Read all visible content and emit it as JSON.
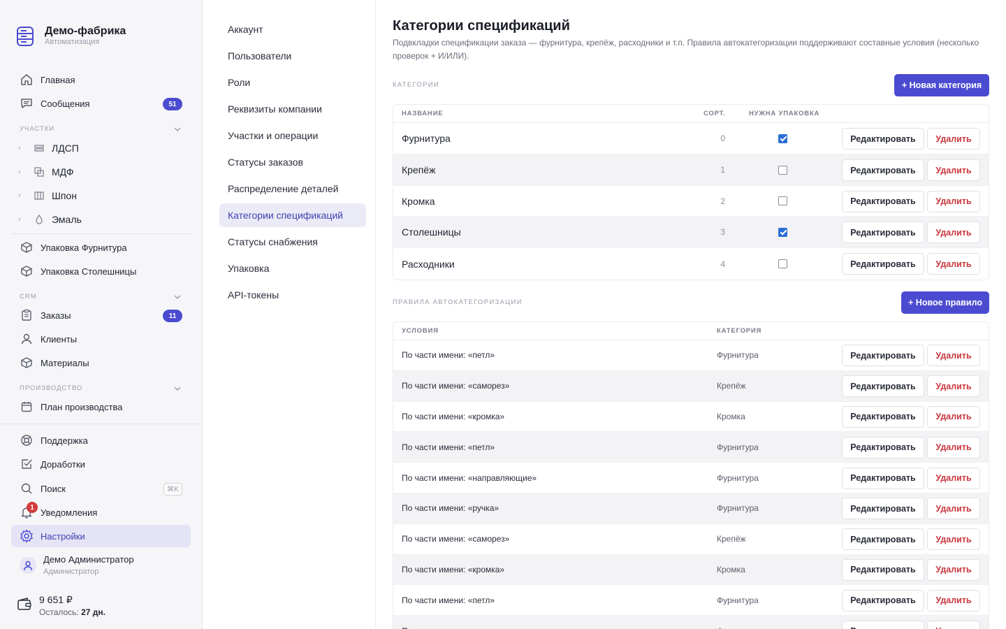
{
  "brand": {
    "name": "Демо-фабрика",
    "subtitle": "Автоматизация"
  },
  "sidebar": {
    "home": "Главная",
    "messages": {
      "label": "Сообщения",
      "badge": "51"
    },
    "sections": {
      "areas": "УЧАСТКИ",
      "crm": "CRM",
      "production": "ПРОИЗВОДСТВО"
    },
    "areas": [
      "ЛДСП",
      "МДФ",
      "Шпон",
      "Эмаль"
    ],
    "packaging": [
      "Упаковка Фурнитура",
      "Упаковка Столешницы"
    ],
    "orders": {
      "label": "Заказы",
      "badge": "11"
    },
    "clients": "Клиенты",
    "materials": "Материалы",
    "plan": "План производства",
    "support": "Поддержка",
    "improvements": "Доработки",
    "search": {
      "label": "Поиск",
      "shortcut": "⌘K"
    },
    "notifications": {
      "label": "Уведомления",
      "count": "1"
    },
    "settings": "Настройки",
    "user": {
      "name": "Демо Администратор",
      "role": "Администратор"
    },
    "wallet": {
      "amount": "9 651 ₽",
      "left_label": "Осталось: ",
      "left_value": "27 дн."
    }
  },
  "settings_menu": [
    "Аккаунт",
    "Пользователи",
    "Роли",
    "Реквизиты компании",
    "Участки и операции",
    "Статусы заказов",
    "Распределение деталей",
    "Категории спецификаций",
    "Статусы снабжения",
    "Упаковка",
    "API-токены"
  ],
  "page": {
    "title": "Категории спецификаций",
    "description": "Подвкладки спецификации заказа — фурнитура, крепёж, расходники и т.п. Правила автокатегоризации поддерживают составные условия (несколько проверок + И/ИЛИ)."
  },
  "categories": {
    "heading": "КАТЕГОРИИ",
    "new_button": "+ Новая категория",
    "columns": {
      "name": "НАЗВАНИЕ",
      "sort": "СОРТ.",
      "pack": "НУЖНА УПАКОВКА"
    },
    "rows": [
      {
        "name": "Фурнитура",
        "sort": "0",
        "pack": true
      },
      {
        "name": "Крепёж",
        "sort": "1",
        "pack": false
      },
      {
        "name": "Кромка",
        "sort": "2",
        "pack": false
      },
      {
        "name": "Столешницы",
        "sort": "3",
        "pack": true
      },
      {
        "name": "Расходники",
        "sort": "4",
        "pack": false
      }
    ]
  },
  "rules": {
    "heading": "ПРАВИЛА АВТОКАТЕГОРИЗАЦИИ",
    "new_button": "+ Новое правило",
    "columns": {
      "conditions": "УСЛОВИЯ",
      "category": "КАТЕГОРИЯ"
    },
    "rows": [
      {
        "condition": "По части имени: «петл»",
        "category": "Фурнитура"
      },
      {
        "condition": "По части имени: «саморез»",
        "category": "Крепёж"
      },
      {
        "condition": "По части имени: «кромка»",
        "category": "Кромка"
      },
      {
        "condition": "По части имени: «петл»",
        "category": "Фурнитура"
      },
      {
        "condition": "По части имени: «направляющие»",
        "category": "Фурнитура"
      },
      {
        "condition": "По части имени: «ручка»",
        "category": "Фурнитура"
      },
      {
        "condition": "По части имени: «саморез»",
        "category": "Крепёж"
      },
      {
        "condition": "По части имени: «кромка»",
        "category": "Кромка"
      },
      {
        "condition": "По части имени: «петл»",
        "category": "Фурнитура"
      },
      {
        "condition": "По части имени: «направляющие»",
        "category": "Фурнитура"
      }
    ]
  },
  "actions": {
    "edit": "Редактировать",
    "delete": "Удалить"
  },
  "colors": {
    "accent": "#4b4bd1",
    "danger": "#c8383e",
    "active_bg": "#e4e4f6"
  }
}
